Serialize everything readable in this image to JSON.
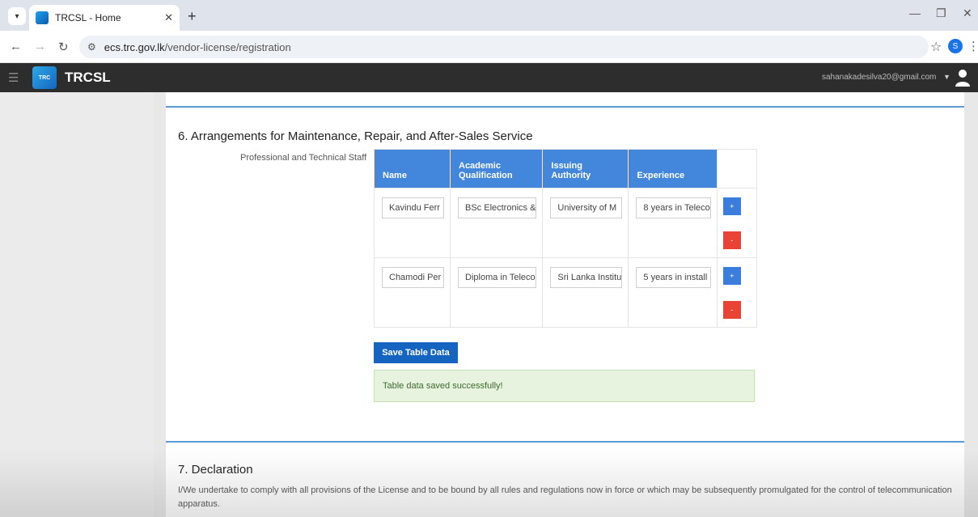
{
  "browser": {
    "tab_title": "TRCSL - Home",
    "url_prefix": "ecs.trc.gov.lk",
    "url_path": "/vendor-license/registration",
    "profile_initial": "S"
  },
  "appbar": {
    "brand": "TRCSL",
    "logo_text": "TRC",
    "user_email": "sahanakadesilva20@gmail.com"
  },
  "section6": {
    "title": "6. Arrangements for Maintenance, Repair, and After-Sales Service",
    "field_label": "Professional and Technical Staff",
    "columns": [
      "Name",
      "Academic Qualification",
      "Issuing Authority",
      "Experience"
    ],
    "rows": [
      {
        "name": "Kavindu Ferr",
        "qualification": "BSc Electronics &",
        "authority": "University of M",
        "experience": "8 years in Teleco"
      },
      {
        "name": "Chamodi Per",
        "qualification": "Diploma in Teleco",
        "authority": "Sri Lanka Institu",
        "experience": "5 years in install"
      }
    ],
    "add_label": "+",
    "remove_label": "-",
    "save_label": "Save Table Data",
    "success_message": "Table data saved successfully!"
  },
  "section7": {
    "title": "7. Declaration",
    "text": "I/We undertake to comply with all provisions of the License and to be bound by all rules and regulations now in force or which may be subsequently promulgated for the control of telecommunication apparatus."
  },
  "colors": {
    "primary": "#1565c0",
    "table_header": "#4287dc",
    "danger": "#e84335",
    "rule": "#5b9bd5",
    "success_bg": "#e8f3df"
  }
}
